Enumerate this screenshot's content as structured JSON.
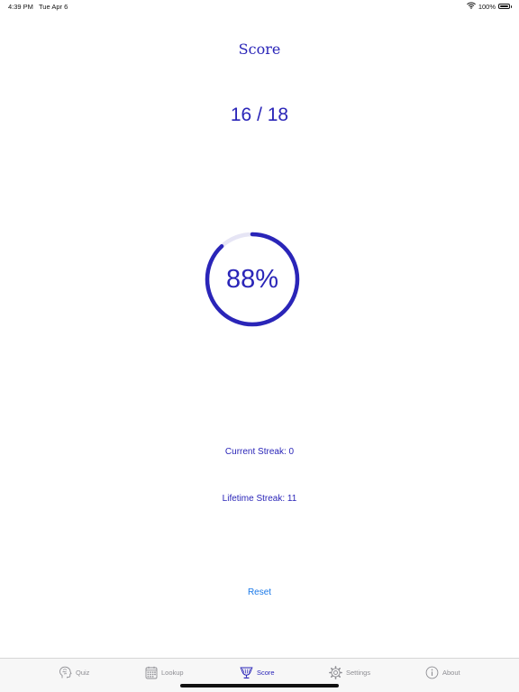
{
  "status_bar": {
    "time": "4:39 PM",
    "date": "Tue Apr 6",
    "battery": "100%",
    "wifi_icon": "wifi-icon",
    "battery_icon": "battery-icon"
  },
  "title": "Score",
  "score": {
    "fraction": "16 / 18",
    "correct": 16,
    "total": 18,
    "percent_label": "88%",
    "percent_value": 0.88
  },
  "streaks": {
    "current": "Current Streak: 0",
    "lifetime": "Lifetime Streak: 11"
  },
  "reset_label": "Reset",
  "tabs": [
    {
      "label": "Quiz",
      "icon": "brain-head-icon",
      "active": false
    },
    {
      "label": "Lookup",
      "icon": "calendar-grid-icon",
      "active": false
    },
    {
      "label": "Score",
      "icon": "trophy-icon",
      "active": true
    },
    {
      "label": "Settings",
      "icon": "gear-icon",
      "active": false
    },
    {
      "label": "About",
      "icon": "info-icon",
      "active": false
    }
  ],
  "colors": {
    "accent": "#2a25b8",
    "link": "#1877e8",
    "ring_track": "#e6e5f5",
    "inactive_tab": "#8e8e93"
  }
}
